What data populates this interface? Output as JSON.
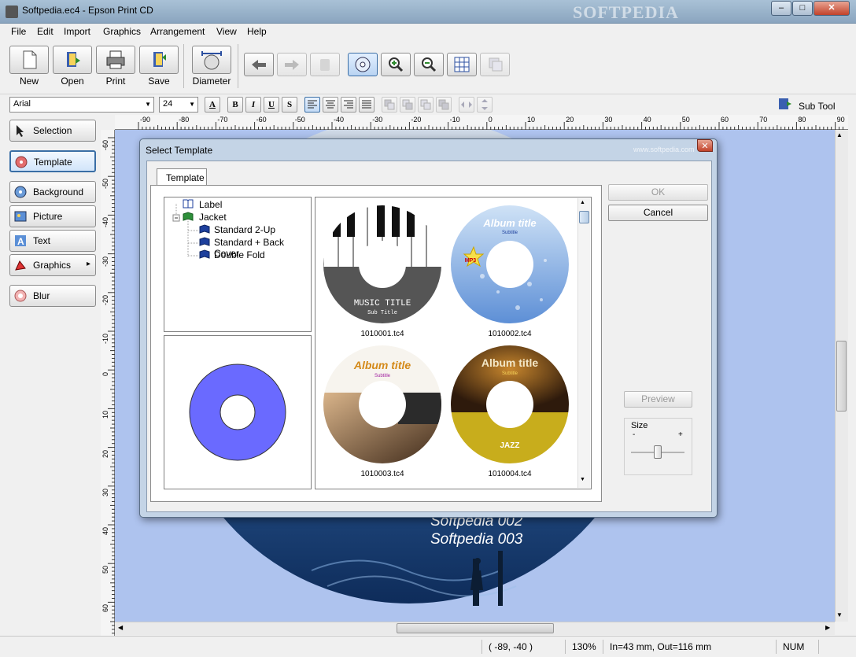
{
  "window": {
    "title": "Softpedia.ec4 - Epson Print CD",
    "watermark": "SOFTPEDIA",
    "controls": {
      "minimize": "–",
      "maximize": "□",
      "close": "✕"
    }
  },
  "menu": [
    "File",
    "Edit",
    "Import",
    "Graphics",
    "Arrangement",
    "View",
    "Help"
  ],
  "toolbar": {
    "new": "New",
    "open": "Open",
    "print": "Print",
    "save": "Save",
    "diameter": "Diameter"
  },
  "format": {
    "font": "Arial",
    "size": "24",
    "bold": "B",
    "italic": "I",
    "underline": "U",
    "shadow": "S",
    "subtool": "Sub Tool"
  },
  "sidebar": {
    "items": [
      {
        "label": "Selection",
        "icon": "cursor-icon"
      },
      {
        "label": "Template",
        "icon": "template-disc-icon"
      },
      {
        "label": "Background",
        "icon": "background-icon"
      },
      {
        "label": "Picture",
        "icon": "picture-icon"
      },
      {
        "label": "Text",
        "icon": "text-icon"
      },
      {
        "label": "Graphics",
        "icon": "graphics-icon",
        "arrow": "▸"
      },
      {
        "label": "Blur",
        "icon": "blur-icon"
      }
    ]
  },
  "ruler": {
    "h": [
      "-90",
      "-80",
      "-70",
      "-60",
      "-50",
      "-40",
      "-30",
      "-20",
      "-10",
      "0",
      "10",
      "20",
      "30",
      "40",
      "50",
      "60",
      "70",
      "80",
      "90"
    ],
    "v": [
      "-60",
      "-50",
      "-40",
      "-30",
      "-20",
      "-10",
      "0",
      "10",
      "20",
      "30",
      "40",
      "50",
      "60"
    ]
  },
  "canvas": {
    "lines": [
      "Softpedia 002",
      "Softpedia 003"
    ]
  },
  "dialog": {
    "title": "Select Template",
    "watermark": "www.softpedia.com",
    "close": "✕",
    "tab": "Template",
    "tree": {
      "label": "Label",
      "jacket": "Jacket",
      "children": [
        "Standard 2-Up",
        "Standard + Back Cover",
        "Double Fold"
      ]
    },
    "templates": [
      {
        "file": "1010001.tc4",
        "title": "MUSIC TITLE",
        "subtitle": "Sub Title"
      },
      {
        "file": "1010002.tc4",
        "title": "Album title",
        "subtitle": "Subtitle",
        "badge": "MP3"
      },
      {
        "file": "1010003.tc4",
        "title": "Album title",
        "subtitle": "Subtitle"
      },
      {
        "file": "1010004.tc4",
        "title": "Album title",
        "subtitle": "Subtitle",
        "footer": "JAZZ"
      }
    ],
    "ok": "OK",
    "cancel": "Cancel",
    "preview": "Preview",
    "size": {
      "label": "Size",
      "minus": "-",
      "plus": "+"
    }
  },
  "status": {
    "coords": "( -89, -40 )",
    "zoom": "130%",
    "dims": "In=43 mm, Out=116 mm",
    "num": "NUM"
  },
  "colors": {
    "canvas_bg": "#aec3ee",
    "disc_preview": "#6a6aff"
  }
}
